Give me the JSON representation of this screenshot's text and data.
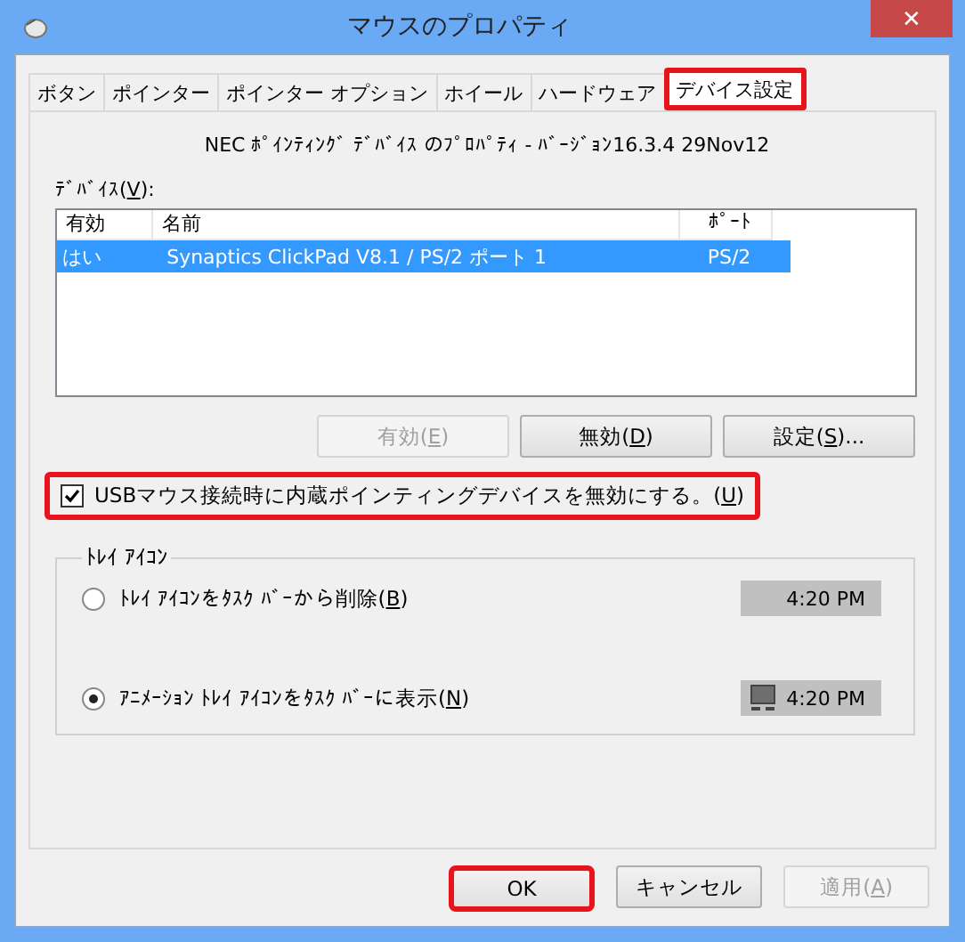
{
  "window": {
    "title": "マウスのプロパティ",
    "close": "✕"
  },
  "tabs": [
    {
      "label": "ボタン",
      "selected": false,
      "highlighted": false
    },
    {
      "label": "ポインター",
      "selected": false,
      "highlighted": false
    },
    {
      "label": "ポインター オプション",
      "selected": false,
      "highlighted": false
    },
    {
      "label": "ホイール",
      "selected": false,
      "highlighted": false
    },
    {
      "label": "ハードウェア",
      "selected": false,
      "highlighted": false
    },
    {
      "label": "デバイス設定",
      "selected": true,
      "highlighted": true
    }
  ],
  "version": "NEC ﾎﾟｲﾝﾃｨﾝｸﾞ ﾃﾞﾊﾞｲｽ のﾌﾟﾛﾊﾟﾃｨ - ﾊﾞｰｼﾞｮﾝ16.3.4 29Nov12",
  "devices_label": [
    "ﾃﾞﾊﾞｲｽ(",
    "V",
    "):"
  ],
  "table": {
    "columns": [
      "有効",
      "名前",
      "ﾎﾟｰﾄ"
    ],
    "rows": [
      {
        "cells": [
          "はい",
          "Synaptics ClickPad V8.1 / PS/2 ポート 1",
          "PS/2"
        ],
        "selected": true
      }
    ]
  },
  "device_buttons": [
    {
      "label": [
        "有効(",
        "E",
        ")"
      ],
      "disabled": true
    },
    {
      "label": [
        "無効(",
        "D",
        ")"
      ],
      "disabled": false
    },
    {
      "label": [
        "設定(",
        "S",
        ")..."
      ],
      "disabled": false
    }
  ],
  "usb_checkbox": {
    "label": [
      "USBマウス接続時に内蔵ポインティングデバイスを無効にする。(",
      "U",
      ")"
    ],
    "checked": true,
    "highlighted": true
  },
  "tray": {
    "title": "ﾄﾚｲ ｱｲｺﾝ",
    "options": [
      {
        "label": [
          "ﾄﾚｲ ｱｲｺﾝをﾀｽｸ ﾊﾞｰから削除(",
          "B",
          ")"
        ],
        "selected": false,
        "clock": "4:20 PM",
        "show_icon": false
      },
      {
        "label": [
          "ｱﾆﾒｰｼｮﾝ ﾄﾚｲ ｱｲｺﾝをﾀｽｸ ﾊﾞｰに表示(",
          "N",
          ")"
        ],
        "selected": true,
        "clock": "4:20 PM",
        "show_icon": true
      }
    ]
  },
  "buttons": [
    {
      "label": [
        "OK"
      ],
      "disabled": false,
      "highlighted": true
    },
    {
      "label": [
        "キャンセル"
      ],
      "disabled": false,
      "highlighted": false
    },
    {
      "label": [
        "適用(",
        "A",
        ")"
      ],
      "disabled": true,
      "highlighted": false
    }
  ]
}
